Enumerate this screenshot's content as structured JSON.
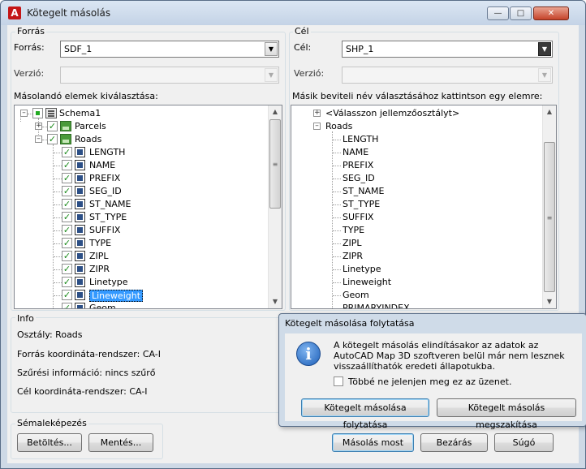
{
  "window": {
    "title": "Kötegelt másolás"
  },
  "source": {
    "group_label": "Forrás",
    "forras_label": "Forrás:",
    "forras_value": "SDF_1",
    "verzio_label": "Verzió:",
    "verzio_value": "",
    "elements_label": "Másolandó elemek kiválasztása:",
    "tree": {
      "schema": "Schema1",
      "parcels": "Parcels",
      "roads": "Roads",
      "fields": [
        "LENGTH",
        "NAME",
        "PREFIX",
        "SEG_ID",
        "ST_NAME",
        "ST_TYPE",
        "SUFFIX",
        "TYPE",
        "ZIPL",
        "ZIPR",
        "Linetype",
        "Lineweight",
        "Geom"
      ]
    }
  },
  "target": {
    "group_label": "Cél",
    "cel_label": "Cél:",
    "cel_value": "SHP_1",
    "verzio_label": "Verzió:",
    "verzio_value": "",
    "elements_label": "Másik beviteli név választásához kattintson egy elemre:",
    "tree": {
      "choose_class": "<Válasszon jellemzőosztályt>",
      "roads": "Roads",
      "fields": [
        "LENGTH",
        "NAME",
        "PREFIX",
        "SEG_ID",
        "ST_NAME",
        "ST_TYPE",
        "SUFFIX",
        "TYPE",
        "ZIPL",
        "ZIPR",
        "Linetype",
        "Lineweight",
        "Geom",
        "PRIMARYINDEX"
      ]
    }
  },
  "info": {
    "group_label": "Info",
    "class_line": "Osztály: Roads",
    "source_crs": "Forrás koordináta-rendszer: CA-I",
    "filter": "Szűrési információ: nincs szűrő",
    "target_crs": "Cél koordináta-rendszer: CA-I"
  },
  "schema_group": {
    "label": "Sémaleképezés",
    "load": "Betöltés...",
    "save": "Mentés..."
  },
  "buttons": {
    "copy_now": "Másolás most",
    "close": "Bezárás",
    "help": "Súgó"
  },
  "popup": {
    "title": "Kötegelt másolása folytatása",
    "message": "A kötegelt másolás elindításakor az adatok az AutoCAD Map 3D szoftveren belül már nem lesznek visszaállíthatók eredeti állapotukba.",
    "checkbox_label": "Többé ne jelenjen meg ez az üzenet.",
    "continue_button": "Kötegelt másolása folytatása",
    "cancel_button": "Kötegelt másolás megszakítása"
  }
}
